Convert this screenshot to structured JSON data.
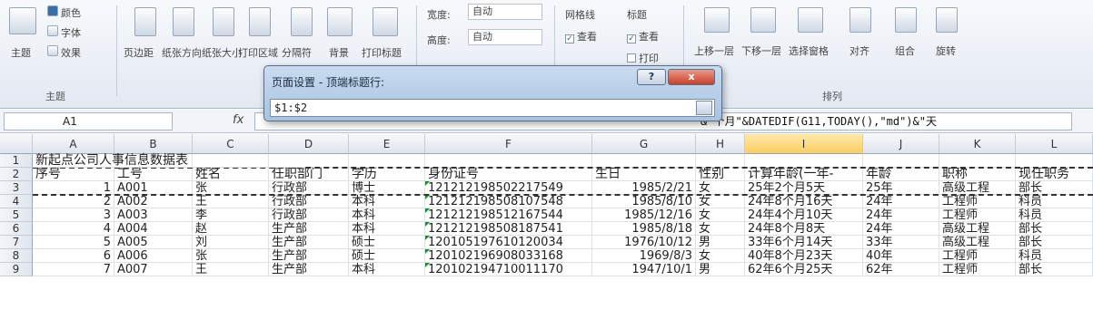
{
  "ribbon": {
    "themes": {
      "theme": "主题",
      "colors": "颜色",
      "fonts": "字体",
      "effects": "效果",
      "group": "主题"
    },
    "page_setup": [
      "页边距",
      "纸张方向",
      "纸张大小",
      "打印区域",
      "分隔符",
      "背景",
      "打印标题"
    ],
    "scale": {
      "width_label": "宽度:",
      "width_value": "自动",
      "height_label": "高度:",
      "height_value": "自动"
    },
    "gridlines": {
      "label": "网格线",
      "view": "查看",
      "print": "打印"
    },
    "headings": {
      "label": "标题",
      "view": "查看",
      "print": "打印"
    },
    "arrange": {
      "items": [
        "上移一层",
        "下移一层",
        "选择窗格",
        "对齐",
        "组合",
        "旋转"
      ],
      "group": "排列"
    }
  },
  "formula_bar": {
    "name_box": "A1",
    "fx": "fx",
    "formula": "&\"个月\"&DATEDIF(G11,TODAY(),\"md\")&\"天"
  },
  "dialog": {
    "title": "页面设置 - 顶端标题行:",
    "help": "?",
    "close": "x",
    "value": "$1:$2"
  },
  "grid": {
    "columns": [
      "A",
      "B",
      "C",
      "D",
      "E",
      "F",
      "G",
      "H",
      "I",
      "J",
      "K",
      "L"
    ],
    "selected_column": "I",
    "title_row": {
      "num": "1",
      "text": "新起点公司人事信息数据表"
    },
    "header_row": {
      "num": "2",
      "cells": [
        "序号",
        "工号",
        "姓名",
        "任职部门",
        "学历",
        "身份证号",
        "生日",
        "性别",
        "计算年龄(一年-",
        "年龄",
        "职称",
        "现任职务"
      ]
    },
    "rows": [
      {
        "num": "3",
        "cells": [
          "1",
          "A001",
          "张",
          "行政部",
          "博士",
          "121212198502217549",
          "1985/2/21",
          "女",
          "25年2个月5天",
          "25年",
          "高级工程",
          "部长"
        ]
      },
      {
        "num": "4",
        "cells": [
          "2",
          "A002",
          "王",
          "行政部",
          "本科",
          "121212198508107548",
          "1985/8/10",
          "女",
          "24年8个月16天",
          "24年",
          "工程师",
          "科员"
        ]
      },
      {
        "num": "5",
        "cells": [
          "3",
          "A003",
          "李",
          "行政部",
          "本科",
          "121212198512167544",
          "1985/12/16",
          "女",
          "24年4个月10天",
          "24年",
          "工程师",
          "科员"
        ]
      },
      {
        "num": "6",
        "cells": [
          "4",
          "A004",
          "赵",
          "生产部",
          "本科",
          "121212198508187541",
          "1985/8/18",
          "女",
          "24年8个月8天",
          "24年",
          "高级工程",
          "部长"
        ]
      },
      {
        "num": "7",
        "cells": [
          "5",
          "A005",
          "刘",
          "生产部",
          "硕士",
          "120105197610120034",
          "1976/10/12",
          "男",
          "33年6个月14天",
          "33年",
          "高级工程",
          "部长"
        ]
      },
      {
        "num": "8",
        "cells": [
          "6",
          "A006",
          "张",
          "生产部",
          "硕士",
          "120102196908033168",
          "1969/8/3",
          "女",
          "40年8个月23天",
          "40年",
          "工程师",
          "科员"
        ]
      },
      {
        "num": "9",
        "cells": [
          "7",
          "A007",
          "王",
          "生产部",
          "本科",
          "120102194710011170",
          "1947/10/1",
          "男",
          "62年6个月25天",
          "62年",
          "工程师",
          "部长"
        ]
      }
    ]
  }
}
